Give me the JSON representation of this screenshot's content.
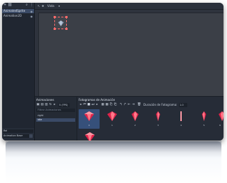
{
  "node_panel": {
    "items": [
      {
        "label": "AnimatedSprite"
      },
      {
        "label": "Animation2D"
      }
    ]
  },
  "inspector": {
    "rows": [
      {
        "label": "Rel"
      },
      {
        "label": "Animation Base"
      }
    ]
  },
  "viewport": {
    "view_label": "Vista"
  },
  "animations_panel": {
    "title": "Animaciones",
    "fps_value": "5 (FPS)",
    "filter_placeholder": "Filtrar Animaciones",
    "items": [
      {
        "label": "right"
      },
      {
        "label": "idle"
      }
    ]
  },
  "frames_panel": {
    "title": "Fotogramas de Animación",
    "frame_count_label": "Duración de Fotograma:",
    "frame_count_value": "1.0",
    "frames": [
      {
        "num": "0"
      },
      {
        "num": "1"
      },
      {
        "num": "2"
      },
      {
        "num": "3"
      },
      {
        "num": "4"
      },
      {
        "num": "5"
      },
      {
        "num": "6"
      }
    ]
  },
  "colors": {
    "gem_red": "#e0234a",
    "gem_light": "#ff7a8a",
    "selection_blue": "#36507a",
    "dock_dark": "#202631"
  }
}
